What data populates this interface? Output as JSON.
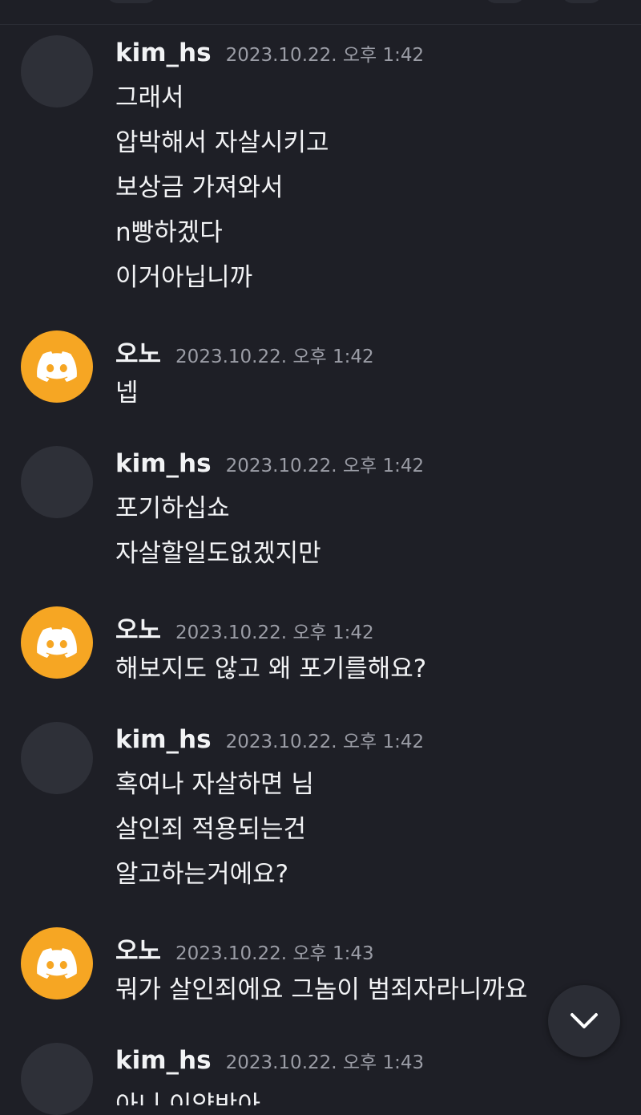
{
  "messages": [
    {
      "author": "kim_hs",
      "avatar": "plain",
      "time": "2023.10.22. 오후 1:42",
      "lines": [
        "그래서",
        "압박해서 자살시키고",
        "보상금 가져와서",
        "n빵하겠다",
        "이거아닙니까"
      ]
    },
    {
      "author": "오노",
      "avatar": "discord-logo-icon",
      "time": "2023.10.22. 오후 1:42",
      "lines": [
        "넵"
      ]
    },
    {
      "author": "kim_hs",
      "avatar": "plain",
      "time": "2023.10.22. 오후 1:42",
      "lines": [
        "포기하십쇼",
        "자살할일도없겠지만"
      ]
    },
    {
      "author": "오노",
      "avatar": "discord-logo-icon",
      "time": "2023.10.22. 오후 1:42",
      "lines": [
        "해보지도 않고 왜 포기를해요?"
      ]
    },
    {
      "author": "kim_hs",
      "avatar": "plain",
      "time": "2023.10.22. 오후 1:42",
      "lines": [
        "혹여나 자살하면 님",
        "살인죄 적용되는건",
        "알고하는거에요?"
      ]
    },
    {
      "author": "오노",
      "avatar": "discord-logo-icon",
      "time": "2023.10.22. 오후 1:43",
      "lines": [
        "뭐가 살인죄에요 그놈이 범죄자라니까요"
      ]
    },
    {
      "author": "kim_hs",
      "avatar": "plain",
      "time": "2023.10.22. 오후 1:43",
      "lines": [
        "아니 이양반아"
      ]
    }
  ],
  "scroll_button": {
    "icon": "chevron-down-icon"
  },
  "colors": {
    "background": "#1e1f26",
    "discord_avatar": "#f6a623",
    "timestamp": "#9b9da6",
    "text": "#f2f3f5"
  }
}
